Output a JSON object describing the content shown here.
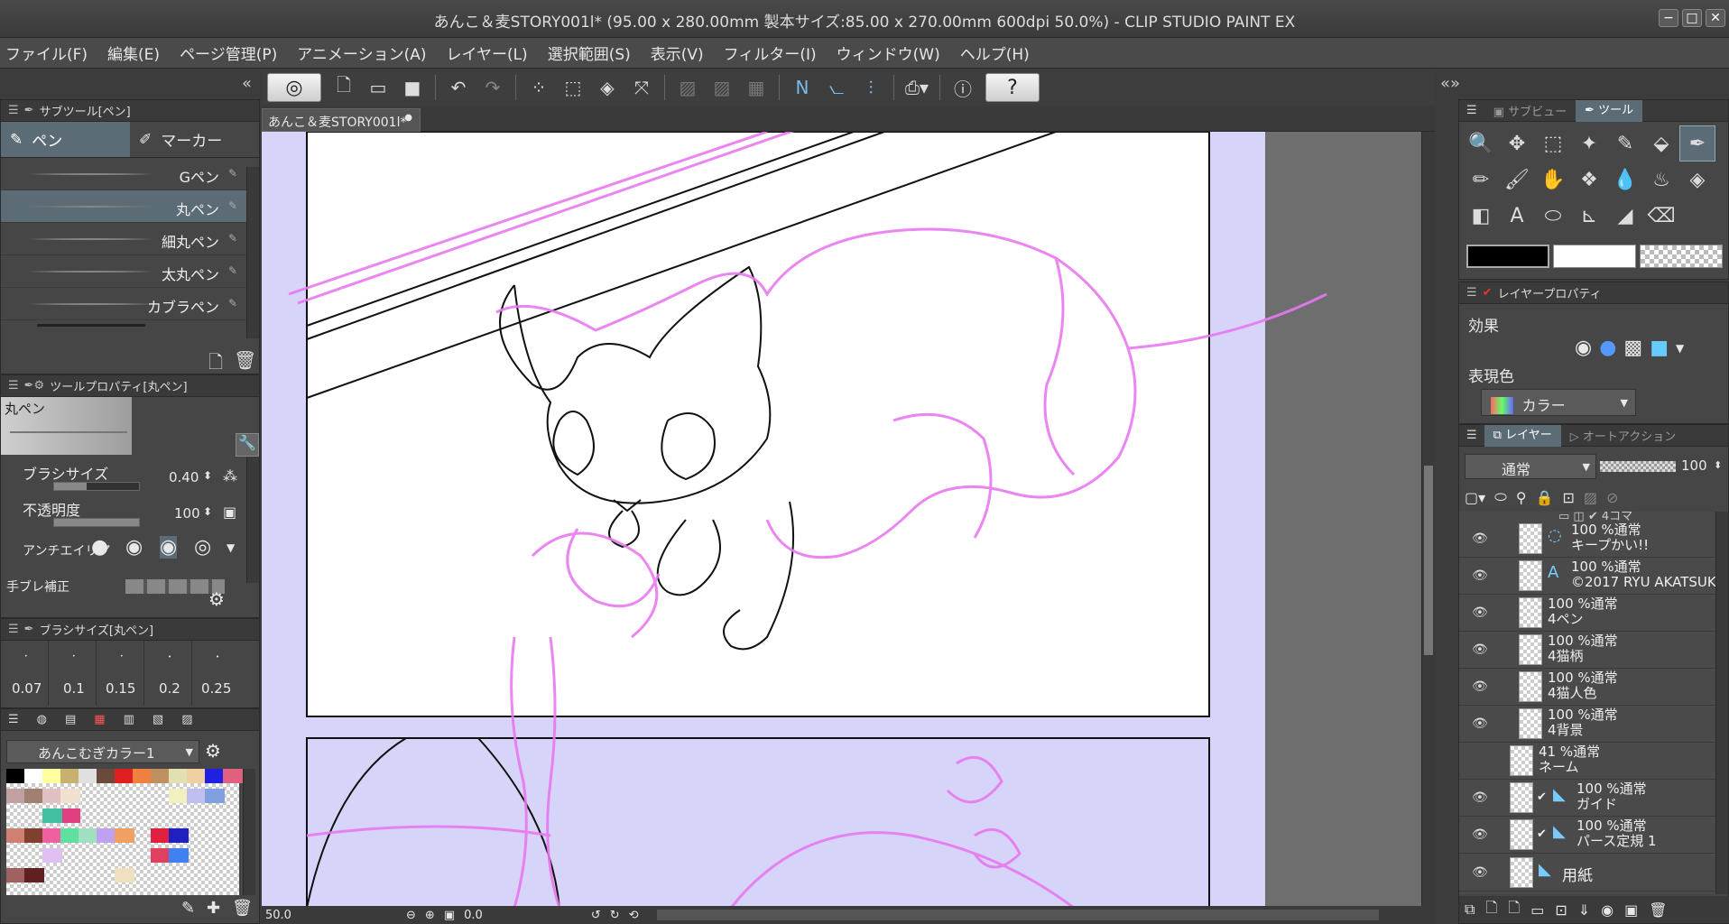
{
  "window": {
    "title": "あんこ＆麦STORY001l* (95.00 x 280.00mm 製本サイズ:85.00 x 270.00mm 600dpi 50.0%)  - CLIP STUDIO PAINT EX",
    "buttons": [
      "−",
      "□",
      "✕"
    ]
  },
  "menu": [
    "ファイル(F)",
    "編集(E)",
    "ページ管理(P)",
    "アニメーション(A)",
    "レイヤー(L)",
    "選択範囲(S)",
    "表示(V)",
    "フィルター(I)",
    "ウィンドウ(W)",
    "ヘルプ(H)"
  ],
  "document_tab": "あんこ＆麦STORY001l*",
  "subtool": {
    "header": "サブツール[ペン]",
    "tabs": [
      "ペン",
      "マーカー"
    ],
    "items": [
      "Gペン",
      "丸ペン",
      "細丸ペン",
      "太丸ペン",
      "カブラペン"
    ],
    "selected_index": 1
  },
  "tool_property": {
    "header": "ツールプロパティ[丸ペン]",
    "preview_label": "丸ペン",
    "brush_size_label": "ブラシサイズ",
    "brush_size_value": "0.40",
    "opacity_label": "不透明度",
    "opacity_value": "100",
    "antialias_label": "アンチエイリア",
    "stabilizer_label": "手ブレ補正"
  },
  "brush_size_panel": {
    "header": "ブラシサイズ[丸ペン]",
    "sizes": [
      "0.07",
      "0.1",
      "0.15",
      "0.2",
      "0.25"
    ]
  },
  "color_set": {
    "name": "あんこむぎカラー1"
  },
  "status": {
    "zoom": "50.0",
    "angle": "0.0"
  },
  "right_top": {
    "tabs": [
      "サブビュー",
      "ツール"
    ]
  },
  "layer_property": {
    "header": "レイヤープロパティ",
    "effect_label": "効果",
    "expression_label": "表現色",
    "expression_value": "カラー"
  },
  "layer_panel": {
    "tabs": [
      "レイヤー",
      "オートアクション"
    ],
    "blend_mode": "通常",
    "opacity": "100",
    "partial_top": "4コマ",
    "layers": [
      {
        "line1": "100 %通常",
        "line2": "キープかい!!"
      },
      {
        "line1": "100 %通常",
        "line2": "©2017 RYU AKATSUKI"
      },
      {
        "line1": "100 %通常",
        "line2": "4ペン"
      },
      {
        "line1": "100 %通常",
        "line2": "4猫柄"
      },
      {
        "line1": "100 %通常",
        "line2": "4猫人色"
      },
      {
        "line1": "100 %通常",
        "line2": "4背景"
      },
      {
        "line1": "41 %通常",
        "line2": "ネーム"
      },
      {
        "line1": "100 %通常",
        "line2": "ガイド"
      },
      {
        "line1": "100 %通常",
        "line2": "パース定規 1"
      },
      {
        "line1": "",
        "line2": "用紙"
      }
    ]
  },
  "colors": {
    "accent": "#5c6c76",
    "sketch": "#e878f0",
    "canvas_margin": "#d6d4f8",
    "main_color": "#000000",
    "sub_color": "#ffffff"
  }
}
